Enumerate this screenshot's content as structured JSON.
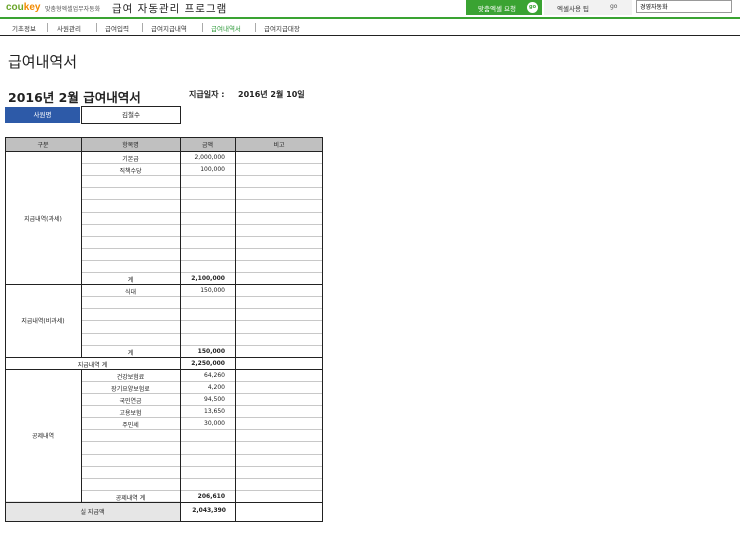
{
  "header": {
    "logo_main": "cou",
    "logo_accent": "key",
    "logo_sub": "맞춤형엑셀업무자동화",
    "app_title": "급여 자동관리 프로그램",
    "request_button": "맞춤엑셀 요청",
    "go_label": "go",
    "tips_button": "엑셀사용 팁",
    "search_value": "경영자동화",
    "accent_color": "#3aa332"
  },
  "nav": {
    "items": [
      "기초정보",
      "사원관리",
      "급여입력",
      "급여지급내역",
      "급여내역서",
      "급여지급대장"
    ],
    "active_index": 4
  },
  "page": {
    "title": "급여내역서",
    "subtitle": "2016년 2월 급여내역서",
    "pay_date_label": "지급일자 :",
    "pay_date_value": "2016년 2월 10일",
    "employee_label": "사원명",
    "employee_name": "김철수"
  },
  "table": {
    "headers": [
      "구분",
      "항목명",
      "금액",
      "비고"
    ],
    "rows": [
      {
        "section": "지급내역(과세)",
        "item": "기본급",
        "amount": "2,000,000"
      },
      {
        "section": "지급내역(과세)",
        "item": "직책수당",
        "amount": "100,000"
      },
      {
        "section": "지급내역(과세)",
        "item": "",
        "amount": ""
      },
      {
        "section": "지급내역(과세)",
        "item": "",
        "amount": ""
      },
      {
        "section": "지급내역(과세)",
        "item": "",
        "amount": ""
      },
      {
        "section": "지급내역(과세)",
        "item": "",
        "amount": ""
      },
      {
        "section": "지급내역(과세)",
        "item": "",
        "amount": ""
      },
      {
        "section": "지급내역(과세)",
        "item": "",
        "amount": ""
      },
      {
        "section": "지급내역(과세)",
        "item": "",
        "amount": ""
      },
      {
        "section": "지급내역(과세)",
        "item": "",
        "amount": ""
      },
      {
        "section": "지급내역(과세)",
        "item": "계",
        "amount": "2,100,000"
      },
      {
        "section": "지급내역(비과세)",
        "item": "식대",
        "amount": "150,000"
      },
      {
        "section": "지급내역(비과세)",
        "item": "",
        "amount": ""
      },
      {
        "section": "지급내역(비과세)",
        "item": "",
        "amount": ""
      },
      {
        "section": "지급내역(비과세)",
        "item": "",
        "amount": ""
      },
      {
        "section": "지급내역(비과세)",
        "item": "",
        "amount": ""
      },
      {
        "section": "지급내역(비과세)",
        "item": "계",
        "amount": "150,000"
      },
      {
        "section": "",
        "item": "지급내역 계",
        "amount": "2,250,000"
      },
      {
        "section": "공제내역",
        "item": "건강보험료",
        "amount": "64,260"
      },
      {
        "section": "공제내역",
        "item": "장기요양보험료",
        "amount": "4,200"
      },
      {
        "section": "공제내역",
        "item": "국민연금",
        "amount": "94,500"
      },
      {
        "section": "공제내역",
        "item": "고용보험",
        "amount": "13,650"
      },
      {
        "section": "공제내역",
        "item": "주민세",
        "amount": "30,000"
      },
      {
        "section": "공제내역",
        "item": "",
        "amount": ""
      },
      {
        "section": "공제내역",
        "item": "",
        "amount": ""
      },
      {
        "section": "공제내역",
        "item": "",
        "amount": ""
      },
      {
        "section": "공제내역",
        "item": "",
        "amount": ""
      },
      {
        "section": "공제내역",
        "item": "",
        "amount": ""
      },
      {
        "section": "공제내역",
        "item": "공제내역 계",
        "amount": "206,610"
      }
    ],
    "net_label": "실 지급액",
    "net_amount": "2,043,390"
  }
}
